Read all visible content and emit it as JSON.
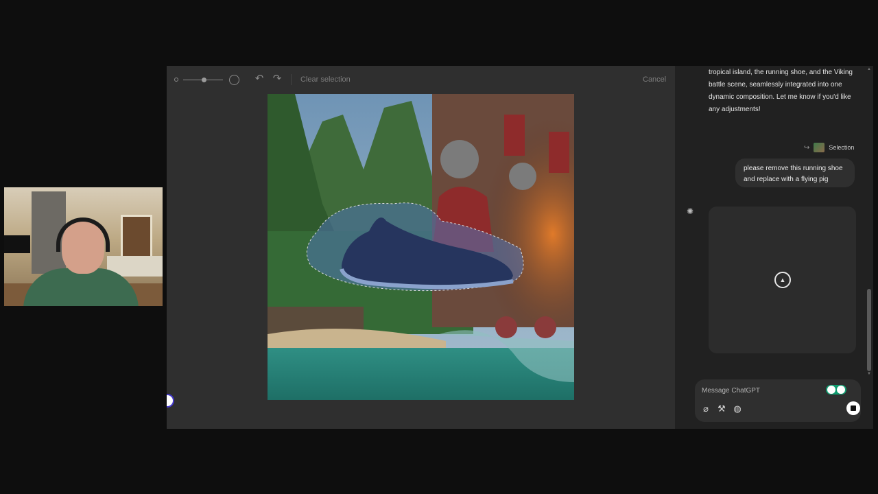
{
  "webcam": {
    "label": "presenter-webcam"
  },
  "editor": {
    "toolbar": {
      "clear_selection_label": "Clear selection",
      "cancel_label": "Cancel",
      "undo_icon": "undo-icon",
      "redo_icon": "redo-icon",
      "brush_size_level": 0.5
    },
    "image": {
      "description_icon": "edited-image"
    }
  },
  "chat": {
    "assistant_message": "tropical island, the running shoe, and the Viking battle scene, seamlessly integrated into one dynamic composition. Let me know if you'd like any adjustments!",
    "selection_label": "Selection",
    "user_message": "please remove this running shoe and replace with a flying pig",
    "composer": {
      "placeholder": "Message ChatGPT",
      "value": ""
    },
    "icons": {
      "attach": "paperclip-icon",
      "tools": "tools-icon",
      "web": "globe-icon",
      "stop": "stop-icon"
    },
    "colors": {
      "accent": "#0f9b6e",
      "bubble": "#2f2f2f",
      "background": "#212121"
    }
  }
}
